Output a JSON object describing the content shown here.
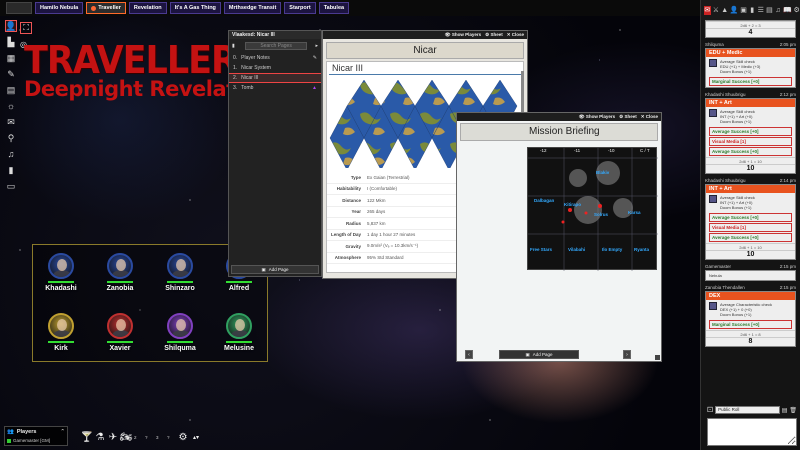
{
  "tabs": [
    {
      "label": "Hamilo Nebula"
    },
    {
      "label": "Traveller"
    },
    {
      "label": "Revelation"
    },
    {
      "label": "It's A Gas Thing"
    },
    {
      "label": "Mrthsedge Transit"
    },
    {
      "label": "Starport"
    },
    {
      "label": "Tabulea"
    }
  ],
  "logo": {
    "line1": "TRAVELLER",
    "line2": "Deepnight Revelation"
  },
  "party": [
    {
      "name": "Khadashi",
      "ring": "#2a4aa0"
    },
    {
      "name": "Zanobia",
      "ring": "#2a4aa0"
    },
    {
      "name": "Shinzaro",
      "ring": "#2a4aa0"
    },
    {
      "name": "Alfred",
      "ring": "#2a4aa0"
    },
    {
      "name": "Kirk",
      "ring": "#c0a030"
    },
    {
      "name": "Xavier",
      "ring": "#c03030"
    },
    {
      "name": "Shilquma",
      "ring": "#8040c0"
    },
    {
      "name": "Melusine",
      "ring": "#30a060"
    }
  ],
  "journal": {
    "header": "Vlaakesd: Nicar III",
    "search_placeholder": "Search Pages",
    "items": [
      "Player Notes",
      "Nicar System",
      "Nicar III",
      "Tomb"
    ],
    "add_page": "Add Page"
  },
  "nicar": {
    "controls": [
      "Show Players",
      "Sheet",
      "Close"
    ],
    "title": "Nicar",
    "subtitle": "Nicar III",
    "props": [
      {
        "k": "Type",
        "v": "Ex Gaian (Terrestrial)"
      },
      {
        "k": "Habitability",
        "v": "I (Comfortable)"
      },
      {
        "k": "Distance",
        "v": "122 Mkm"
      },
      {
        "k": "Year",
        "v": "265 days"
      },
      {
        "k": "Radius",
        "v": "5,837 km"
      },
      {
        "k": "Length of Day",
        "v": "1 day 1 hour 27 minutes"
      },
      {
        "k": "Gravity",
        "v": "9.0m/s² (Vₑ = 10.3km/s⁻¹)"
      },
      {
        "k": "Atmosphere",
        "v": "95% Std Standard"
      }
    ]
  },
  "mission": {
    "controls": [
      "Show Players",
      "Sheet",
      "Close"
    ],
    "title": "Mission Briefing",
    "add_page": "Add Page",
    "cols": [
      "-12",
      "-11",
      "-10",
      "C / T"
    ],
    "hexes": [
      "Blakiv",
      "Dalbagan",
      "Kitirapo",
      "Solrus",
      "Karsa",
      "Free Stars",
      "Vilabahi",
      "Ilo Empty",
      "Ryanta"
    ]
  },
  "sidebar": {
    "top_roll": "2d6 + 2 = 3",
    "top_result": "4",
    "messages": [
      {
        "who": "Shilquma",
        "time": "2:05 pm",
        "head": "EDU + Medic",
        "skill": "Average Skill check",
        "skill_sub": "EDU (+1) + Medic (+3)",
        "sub2": "Doom Bonus (+1)",
        "results": [
          {
            "t": "Marginal Success [+0]",
            "red": false
          }
        ],
        "roll": "",
        "num": ""
      },
      {
        "who": "Khadashi Shuubrigu",
        "time": "2:12 pm",
        "head": "INT + Art",
        "skill": "Average Skill check",
        "skill_sub": "INT (+1) + Art (+0)",
        "sub2": "Doom Bonus (+1)",
        "results": [
          {
            "t": "Average Success [+0]",
            "red": false
          },
          {
            "t": "Visual Media [1]",
            "red": true
          },
          {
            "t": "Average Success [+0]",
            "red": false
          }
        ],
        "roll": "2d6 + 1 = 10",
        "num": "10"
      },
      {
        "who": "Khadashi Shuubrigu",
        "time": "2:14 pm",
        "head": "INT + Art",
        "skill": "Average Skill check",
        "skill_sub": "INT (+1) + Art (+0)",
        "sub2": "Doom Bonus (+1)",
        "results": [
          {
            "t": "Average Success [+0]",
            "red": false
          },
          {
            "t": "Visual Media [1]",
            "red": true
          },
          {
            "t": "Average Success [+0]",
            "red": false
          }
        ],
        "roll": "2d6 + 1 = 10",
        "num": "10"
      },
      {
        "who": "Gamemaster",
        "time": "2:15 pm",
        "head": "",
        "skill": "Nebula",
        "skill_sub": "",
        "sub2": "",
        "results": [],
        "roll": "",
        "num": ""
      },
      {
        "who": "Zanobia Thendallen",
        "time": "2:15 pm",
        "head": "DEX",
        "skill": "Average Characteristic check",
        "skill_sub": "DEX (+1) + 0 (+0)",
        "sub2": "Doom Bonus (+1)",
        "results": [
          {
            "t": "Marginal Success [+0]",
            "red": false
          }
        ],
        "roll": "2d6 + 1 = 8",
        "num": "8"
      }
    ],
    "roll_mode": "Public Roll"
  },
  "players": {
    "title": "Players",
    "gm": "Gamemaster [GM]"
  },
  "hotbar": {
    "slots": [
      "🍸",
      "⚗",
      "✈",
      "🏍",
      "⚙"
    ],
    "nums": [
      "2",
      "?",
      "3",
      "?"
    ]
  }
}
